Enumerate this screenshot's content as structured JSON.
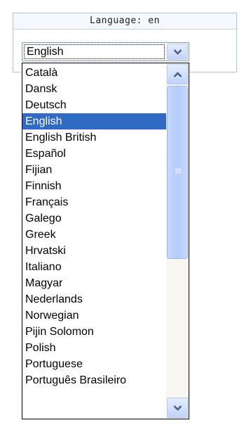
{
  "panel": {
    "title": "Language: en"
  },
  "select": {
    "selected_value": "English",
    "options": [
      "Català",
      "Dansk",
      "Deutsch",
      "English",
      "English British",
      "Español",
      "Fijian",
      "Finnish",
      "Français",
      "Galego",
      "Greek",
      "Hrvatski",
      "Italiano",
      "Magyar",
      "Nederlands",
      "Norwegian",
      "Pijin Solomon",
      "Polish",
      "Portuguese",
      "Português Brasileiro"
    ],
    "selected_index": 3
  },
  "icons": {
    "dropdown": "chevron-down-icon",
    "scroll_up": "chevron-up-icon",
    "scroll_down": "chevron-down-icon"
  },
  "colors": {
    "selection": "#316ac5",
    "panel_border": "#b0c4dc"
  }
}
